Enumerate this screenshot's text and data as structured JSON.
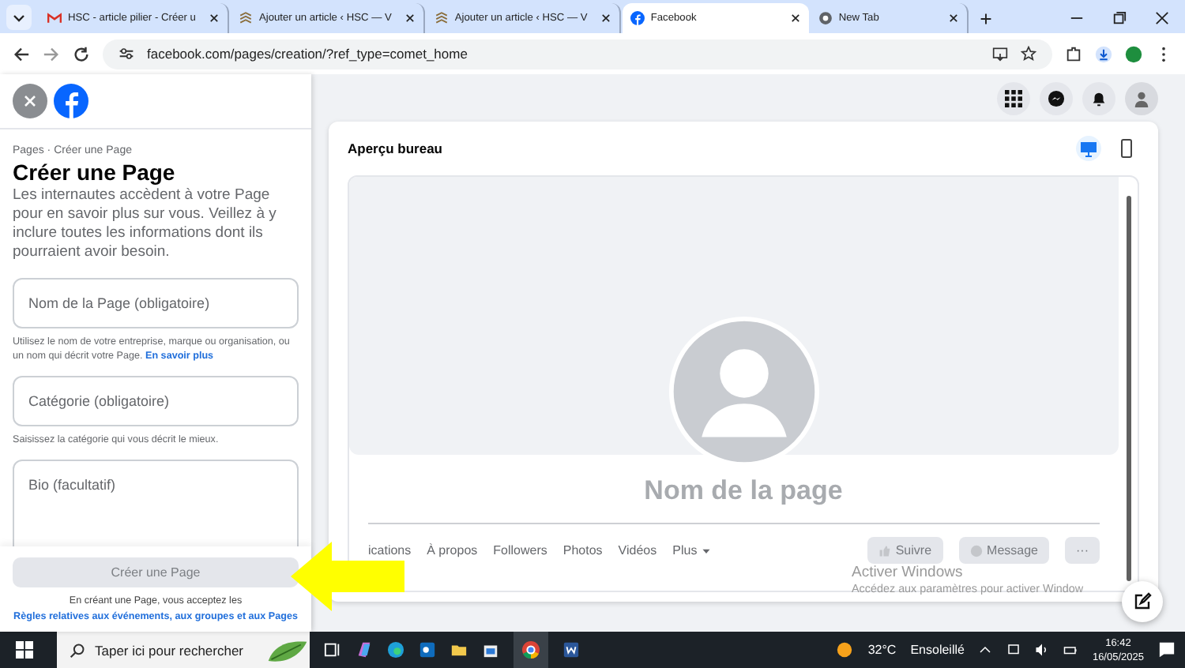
{
  "browser": {
    "tabs": [
      {
        "title": "HSC - article pilier - Créer u",
        "kind": "mail",
        "selected": false
      },
      {
        "title": "Ajouter un article ‹ HSC — V",
        "kind": "stack",
        "selected": false
      },
      {
        "title": "Ajouter un article ‹ HSC — V",
        "kind": "stack",
        "selected": false
      },
      {
        "title": "Facebook",
        "kind": "facebook",
        "selected": true
      },
      {
        "title": "New Tab",
        "kind": "chrome",
        "selected": false
      }
    ],
    "url": "facebook.com/pages/creation/?ref_type=comet_home"
  },
  "form": {
    "breadcrumb": "Pages · Créer une Page",
    "title": "Créer une Page",
    "description": "Les internautes accèdent à votre Page pour en savoir plus sur vous. Veillez à y inclure toutes les informations dont ils pourraient avoir besoin.",
    "fields": [
      {
        "kind": "input",
        "placeholder": "Nom de la Page (obligatoire)",
        "help": "Utilisez le nom de votre entreprise, marque ou organisation, ou un nom qui décrit votre Page.",
        "help_link": "En savoir plus"
      },
      {
        "kind": "input",
        "placeholder": "Catégorie (obligatoire)",
        "help": "Saisissez la catégorie qui vous décrit le mieux."
      },
      {
        "kind": "textarea",
        "placeholder": "Bio (facultatif)"
      }
    ],
    "submit": {
      "label": "Créer une Page",
      "disabled": true
    },
    "terms": "En créant une Page, vous acceptez les",
    "terms_link": "Règles relatives aux événements, aux groupes et aux Pages"
  },
  "preview": {
    "title": "Aperçu bureau",
    "views": [
      {
        "kind": "desktop",
        "selected": true
      },
      {
        "kind": "mobile",
        "selected": false
      }
    ],
    "page_name": "Nom de la page",
    "tabs": [
      "ications",
      "À propos",
      "Followers",
      "Photos",
      "Vidéos",
      "Plus"
    ],
    "actions": [
      {
        "kind": "follow",
        "label": "Suivre"
      },
      {
        "kind": "message",
        "label": "Message"
      },
      {
        "kind": "more",
        "label": "···"
      }
    ]
  },
  "activation": {
    "title": "Activer Windows",
    "text": "Accédez aux paramètres pour activer Window"
  },
  "taskbar": {
    "search": "Taper ici pour rechercher",
    "temperature": "32°C",
    "weather": "Ensoleillé",
    "time": "16:42",
    "date": "16/05/2025"
  }
}
